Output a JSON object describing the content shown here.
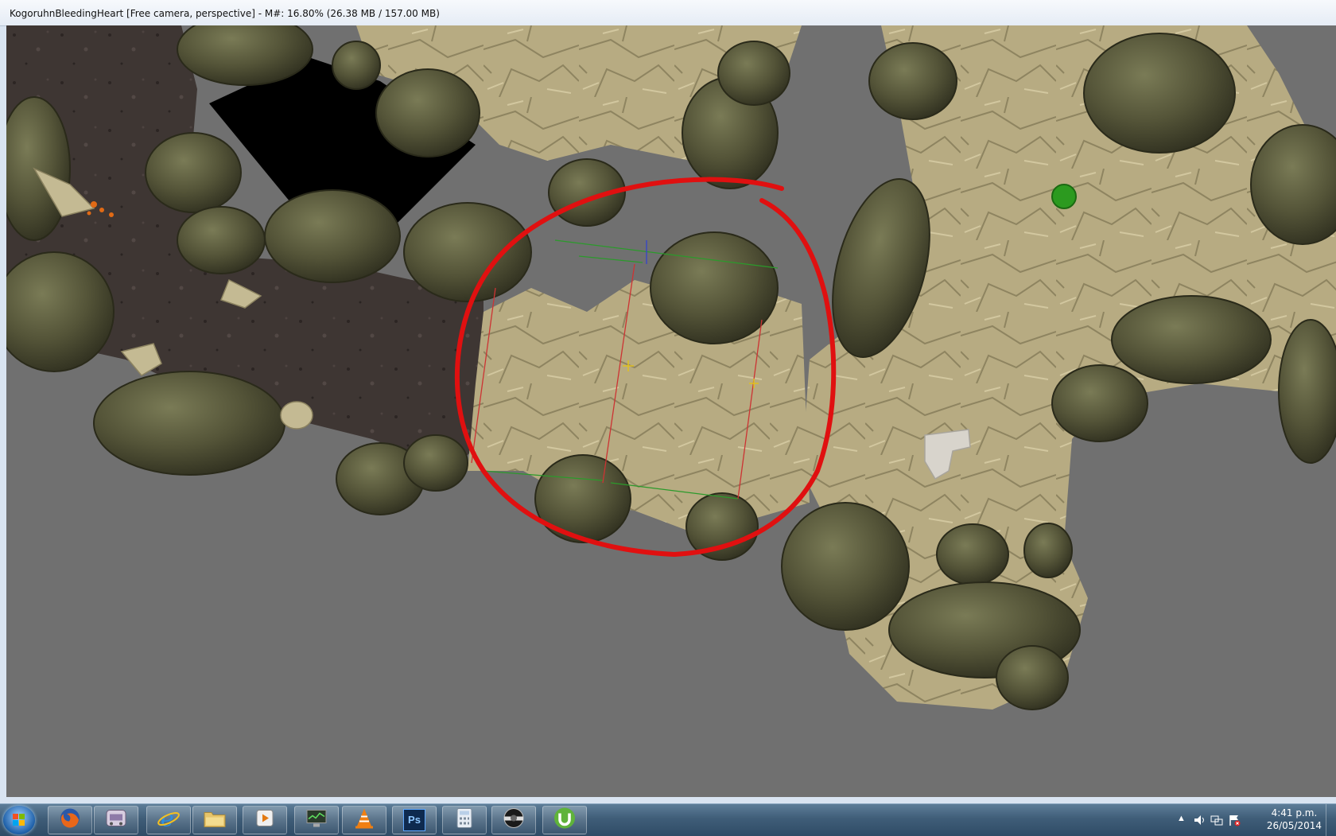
{
  "window": {
    "title": "KogoruhnBleedingHeart [Free camera, perspective] - M#: 16.80% (26.38 MB / 157.00 MB)"
  },
  "viewport": {
    "background": "#707070",
    "annotation_color": "#e01010"
  },
  "taskbar": {
    "start_icon": "windows-start-icon",
    "apps": [
      {
        "name": "firefox",
        "icon": "firefox-icon"
      },
      {
        "name": "game-controller",
        "icon": "gamepad-icon"
      },
      {
        "name": "internet-explorer",
        "icon": "ie-icon"
      },
      {
        "name": "file-explorer",
        "icon": "folder-icon"
      },
      {
        "name": "media-player",
        "icon": "media-player-icon"
      },
      {
        "name": "task-manager",
        "icon": "monitor-icon"
      },
      {
        "name": "vlc",
        "icon": "vlc-cone-icon"
      },
      {
        "name": "photoshop",
        "icon": "photoshop-icon",
        "label": "Ps"
      },
      {
        "name": "calculator",
        "icon": "calculator-icon"
      },
      {
        "name": "creation-kit",
        "icon": "creation-kit-icon"
      },
      {
        "name": "utorrent",
        "icon": "utorrent-icon"
      }
    ],
    "tray": {
      "clock_time": "4:41 p.m.",
      "clock_date": "26/05/2014"
    }
  }
}
